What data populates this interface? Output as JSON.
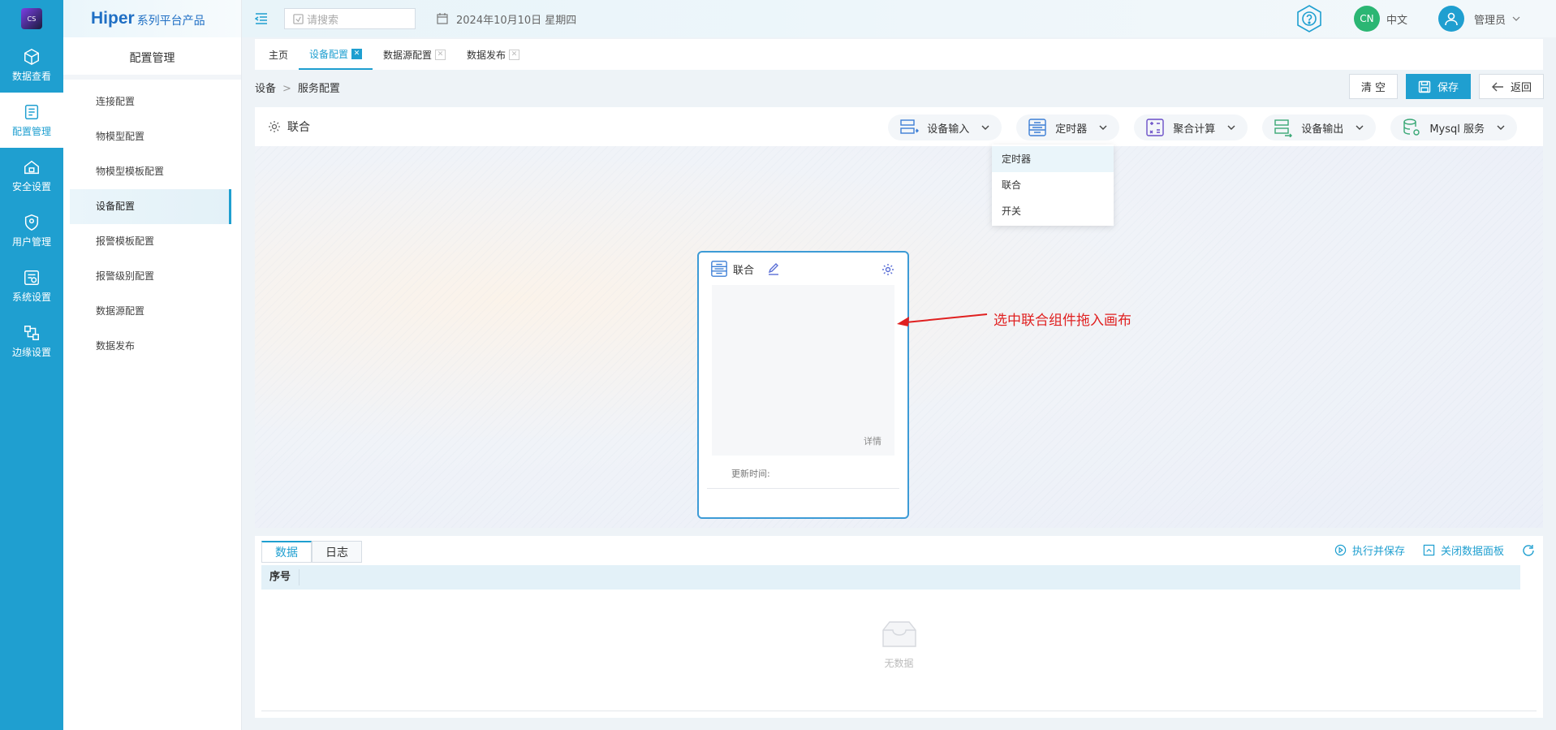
{
  "rail": {
    "logo_text": "CS",
    "items": [
      {
        "label": "数据查看",
        "icon": "cube-icon"
      },
      {
        "label": "配置管理",
        "icon": "config-icon"
      },
      {
        "label": "安全设置",
        "icon": "house-lock-icon"
      },
      {
        "label": "用户管理",
        "icon": "shield-user-icon"
      },
      {
        "label": "系统设置",
        "icon": "system-gear-icon"
      },
      {
        "label": "边缘设置",
        "icon": "edge-network-icon"
      }
    ]
  },
  "brand": {
    "name": "Hiper",
    "subtitle": "系列平台产品"
  },
  "subside": {
    "title": "配置管理",
    "items": [
      "连接配置",
      "物模型配置",
      "物模型模板配置",
      "设备配置",
      "报警模板配置",
      "报警级别配置",
      "数据源配置",
      "数据发布"
    ]
  },
  "topbar": {
    "search_placeholder": "请搜索",
    "date": "2024年10月10日 星期四",
    "lang_badge": "CN",
    "lang": "中文",
    "user": "管理员"
  },
  "tabs": [
    "主页",
    "设备配置",
    "数据源配置",
    "数据发布"
  ],
  "breadcrumb": {
    "root": "设备",
    "sep": ">",
    "current": "服务配置"
  },
  "actions": {
    "clear": "清 空",
    "save": "保存",
    "back": "返回"
  },
  "toolbar": {
    "component": "联合",
    "tools": [
      "设备输入",
      "定时器",
      "聚合计算",
      "设备输出",
      "Mysql 服务"
    ]
  },
  "dropdown": [
    "定时器",
    "联合",
    "开关"
  ],
  "node": {
    "title": "联合",
    "detail": "详情",
    "update_label": "更新时间:"
  },
  "annotation": "选中联合组件拖入画布",
  "panel": {
    "tabs": [
      "数据",
      "日志"
    ],
    "exec_save": "执行并保存",
    "close_panel": "关闭数据面板",
    "column": "序号",
    "empty": "无数据"
  },
  "colors": {
    "accent": "#1f9fd0",
    "annotation": "#e02020",
    "lang_badge": "#2bb673"
  }
}
